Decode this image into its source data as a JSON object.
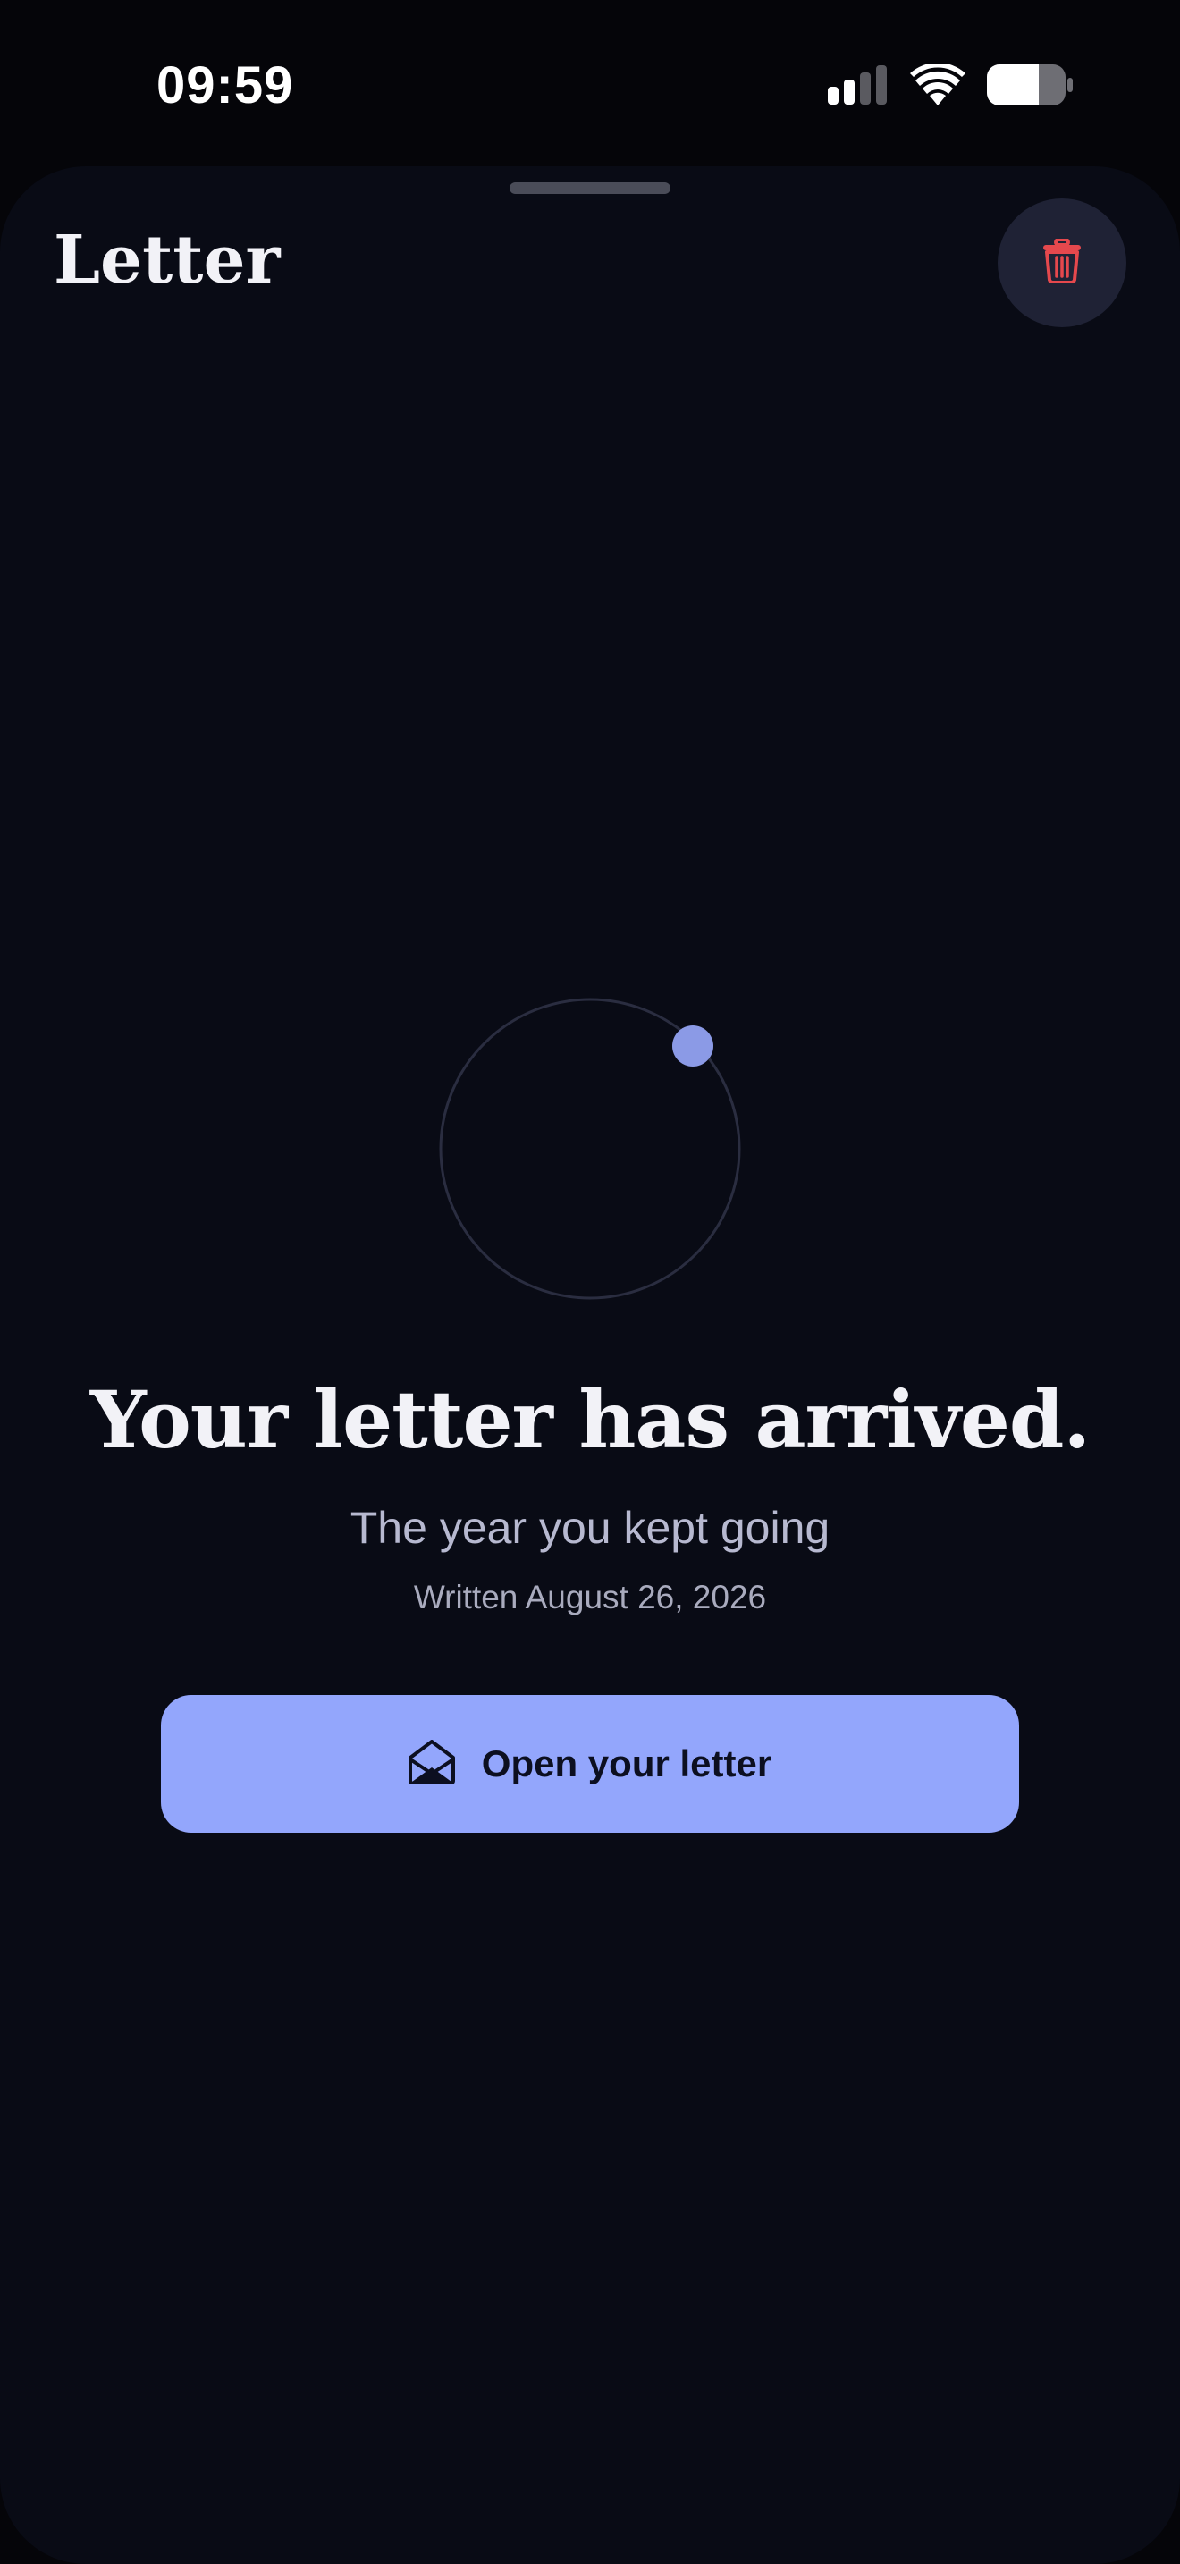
{
  "status_bar": {
    "time": "09:59",
    "icons": [
      "cellular-signal-icon",
      "wifi-icon",
      "battery-icon"
    ]
  },
  "sheet": {
    "title": "Letter",
    "delete_icon": "trash-icon"
  },
  "letter": {
    "headline": "Your letter has arrived.",
    "subtitle": "The year you kept going",
    "written": "Written August 26, 2026",
    "open_label": "Open your letter",
    "open_icon": "envelope-open-icon"
  },
  "colors": {
    "background": "#050509",
    "sheet": "#090b15",
    "accent": "#93a6fc",
    "danger": "#e5484d",
    "orbit_dot": "#8b9ae6",
    "orbit_ring": "#2a2d40"
  }
}
